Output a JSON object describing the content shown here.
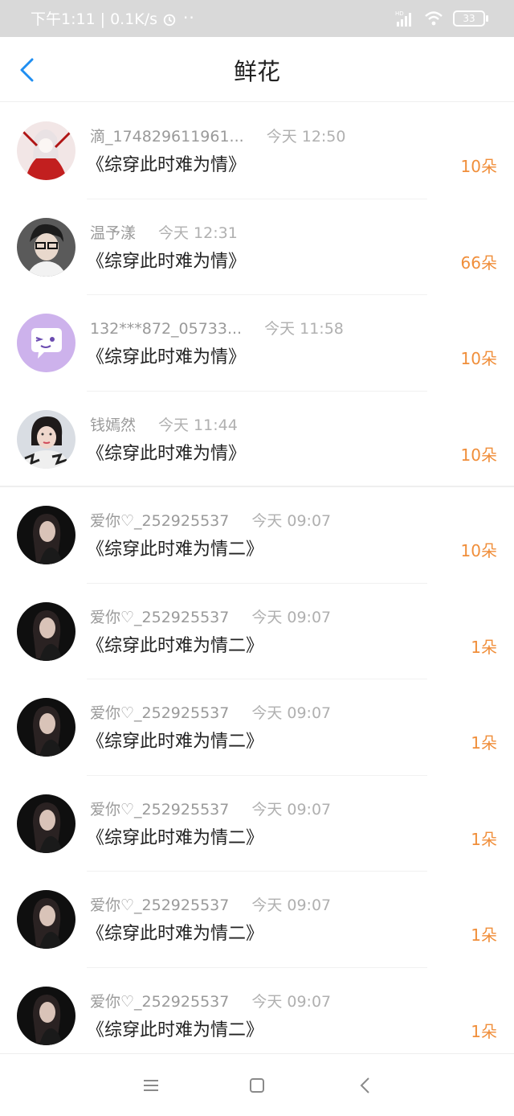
{
  "status_bar": {
    "time": "下午1:11",
    "speed": "0.1K/s",
    "battery": "33",
    "dots": "··",
    "hd": "HD"
  },
  "header": {
    "title": "鲜花"
  },
  "colors": {
    "accent": "#1f8ef1",
    "amount": "#f08e3a",
    "meta": "#9a9a9a"
  },
  "items": [
    {
      "name": "滴_174829611961...",
      "time": "今天 12:50",
      "book": "《综穿此时难为情》",
      "amount": "10朵",
      "avatar": "anime-girl-red-avatar"
    },
    {
      "name": "温予漾",
      "time": "今天 12:31",
      "book": "《综穿此时难为情》",
      "amount": "66朵",
      "avatar": "boy-glasses-avatar"
    },
    {
      "name": "132***872_05733...",
      "time": "今天 11:58",
      "book": "《综穿此时难为情》",
      "amount": "10朵",
      "avatar": "purple-chat-avatar"
    },
    {
      "name": "钱嫣然",
      "time": "今天 11:44",
      "book": "《综穿此时难为情》",
      "amount": "10朵",
      "avatar": "woman-photo-avatar"
    },
    {
      "name": "爱你♡_252925537",
      "time": "今天 09:07",
      "book": "《综穿此时难为情二》",
      "amount": "10朵",
      "avatar": "dark-portrait-avatar"
    },
    {
      "name": "爱你♡_252925537",
      "time": "今天 09:07",
      "book": "《综穿此时难为情二》",
      "amount": "1朵",
      "avatar": "dark-portrait-avatar"
    },
    {
      "name": "爱你♡_252925537",
      "time": "今天 09:07",
      "book": "《综穿此时难为情二》",
      "amount": "1朵",
      "avatar": "dark-portrait-avatar"
    },
    {
      "name": "爱你♡_252925537",
      "time": "今天 09:07",
      "book": "《综穿此时难为情二》",
      "amount": "1朵",
      "avatar": "dark-portrait-avatar"
    },
    {
      "name": "爱你♡_252925537",
      "time": "今天 09:07",
      "book": "《综穿此时难为情二》",
      "amount": "1朵",
      "avatar": "dark-portrait-avatar"
    },
    {
      "name": "爱你♡_252925537",
      "time": "今天 09:07",
      "book": "《综穿此时难为情二》",
      "amount": "1朵",
      "avatar": "dark-portrait-avatar"
    }
  ],
  "bottom_nav": {
    "icons": [
      "menu-icon",
      "home-square-icon",
      "back-chevron-icon"
    ]
  }
}
